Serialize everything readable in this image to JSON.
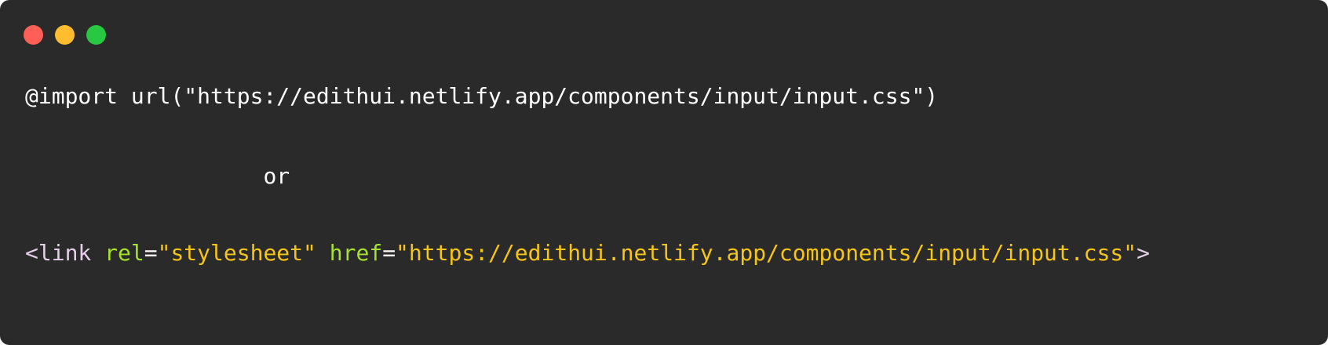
{
  "window": {
    "background": "#2a2a2a",
    "controls": [
      {
        "name": "close",
        "color": "#ff5f57"
      },
      {
        "name": "minimize",
        "color": "#febc2e"
      },
      {
        "name": "maximize",
        "color": "#28c840"
      }
    ]
  },
  "code": {
    "colors": {
      "plain": "#ffffff",
      "tag": "#e5cfe8",
      "attribute": "#a6e22e",
      "string": "#f5c518"
    },
    "import_line": "@import url(\"https://edithui.netlify.app/components/input/input.css\")",
    "separator_indent": "                  ",
    "separator": "or",
    "link_line": {
      "tag_open": "<link",
      "space1": " ",
      "attr1": "rel",
      "eq1": "=",
      "val1": "\"stylesheet\"",
      "space2": " ",
      "attr2": "href",
      "eq2": "=",
      "val2": "\"https://edithui.netlify.app/components/input/input.css\"",
      "tag_close": ">"
    }
  }
}
